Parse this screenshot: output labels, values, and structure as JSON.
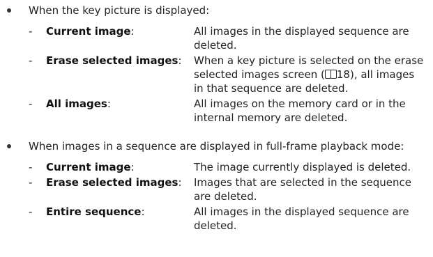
{
  "sections": [
    {
      "bullet": "When the key picture is displayed:",
      "items": [
        {
          "term": "Current image",
          "desc": "All images in the displayed sequence are deleted."
        },
        {
          "term": "Erase selected images",
          "desc_before_ref": "When a key picture is selected on the erase selected images screen (",
          "ref_page": "18",
          "desc_after_ref": "), all images in that sequence are deleted."
        },
        {
          "term": "All images",
          "desc": "All images on the memory card or in the internal memory are deleted."
        }
      ]
    },
    {
      "bullet": "When images in a sequence are displayed in full-frame playback mode:",
      "items": [
        {
          "term": "Current image",
          "desc": "The image currently displayed is deleted."
        },
        {
          "term": "Erase selected images",
          "desc": "Images that are selected in the sequence are deleted."
        },
        {
          "term": "Entire sequence",
          "desc": "All images in the displayed sequence are deleted."
        }
      ]
    }
  ],
  "dash": "-",
  "colon": ":",
  "ref_icon": "manual-page-reference-icon"
}
